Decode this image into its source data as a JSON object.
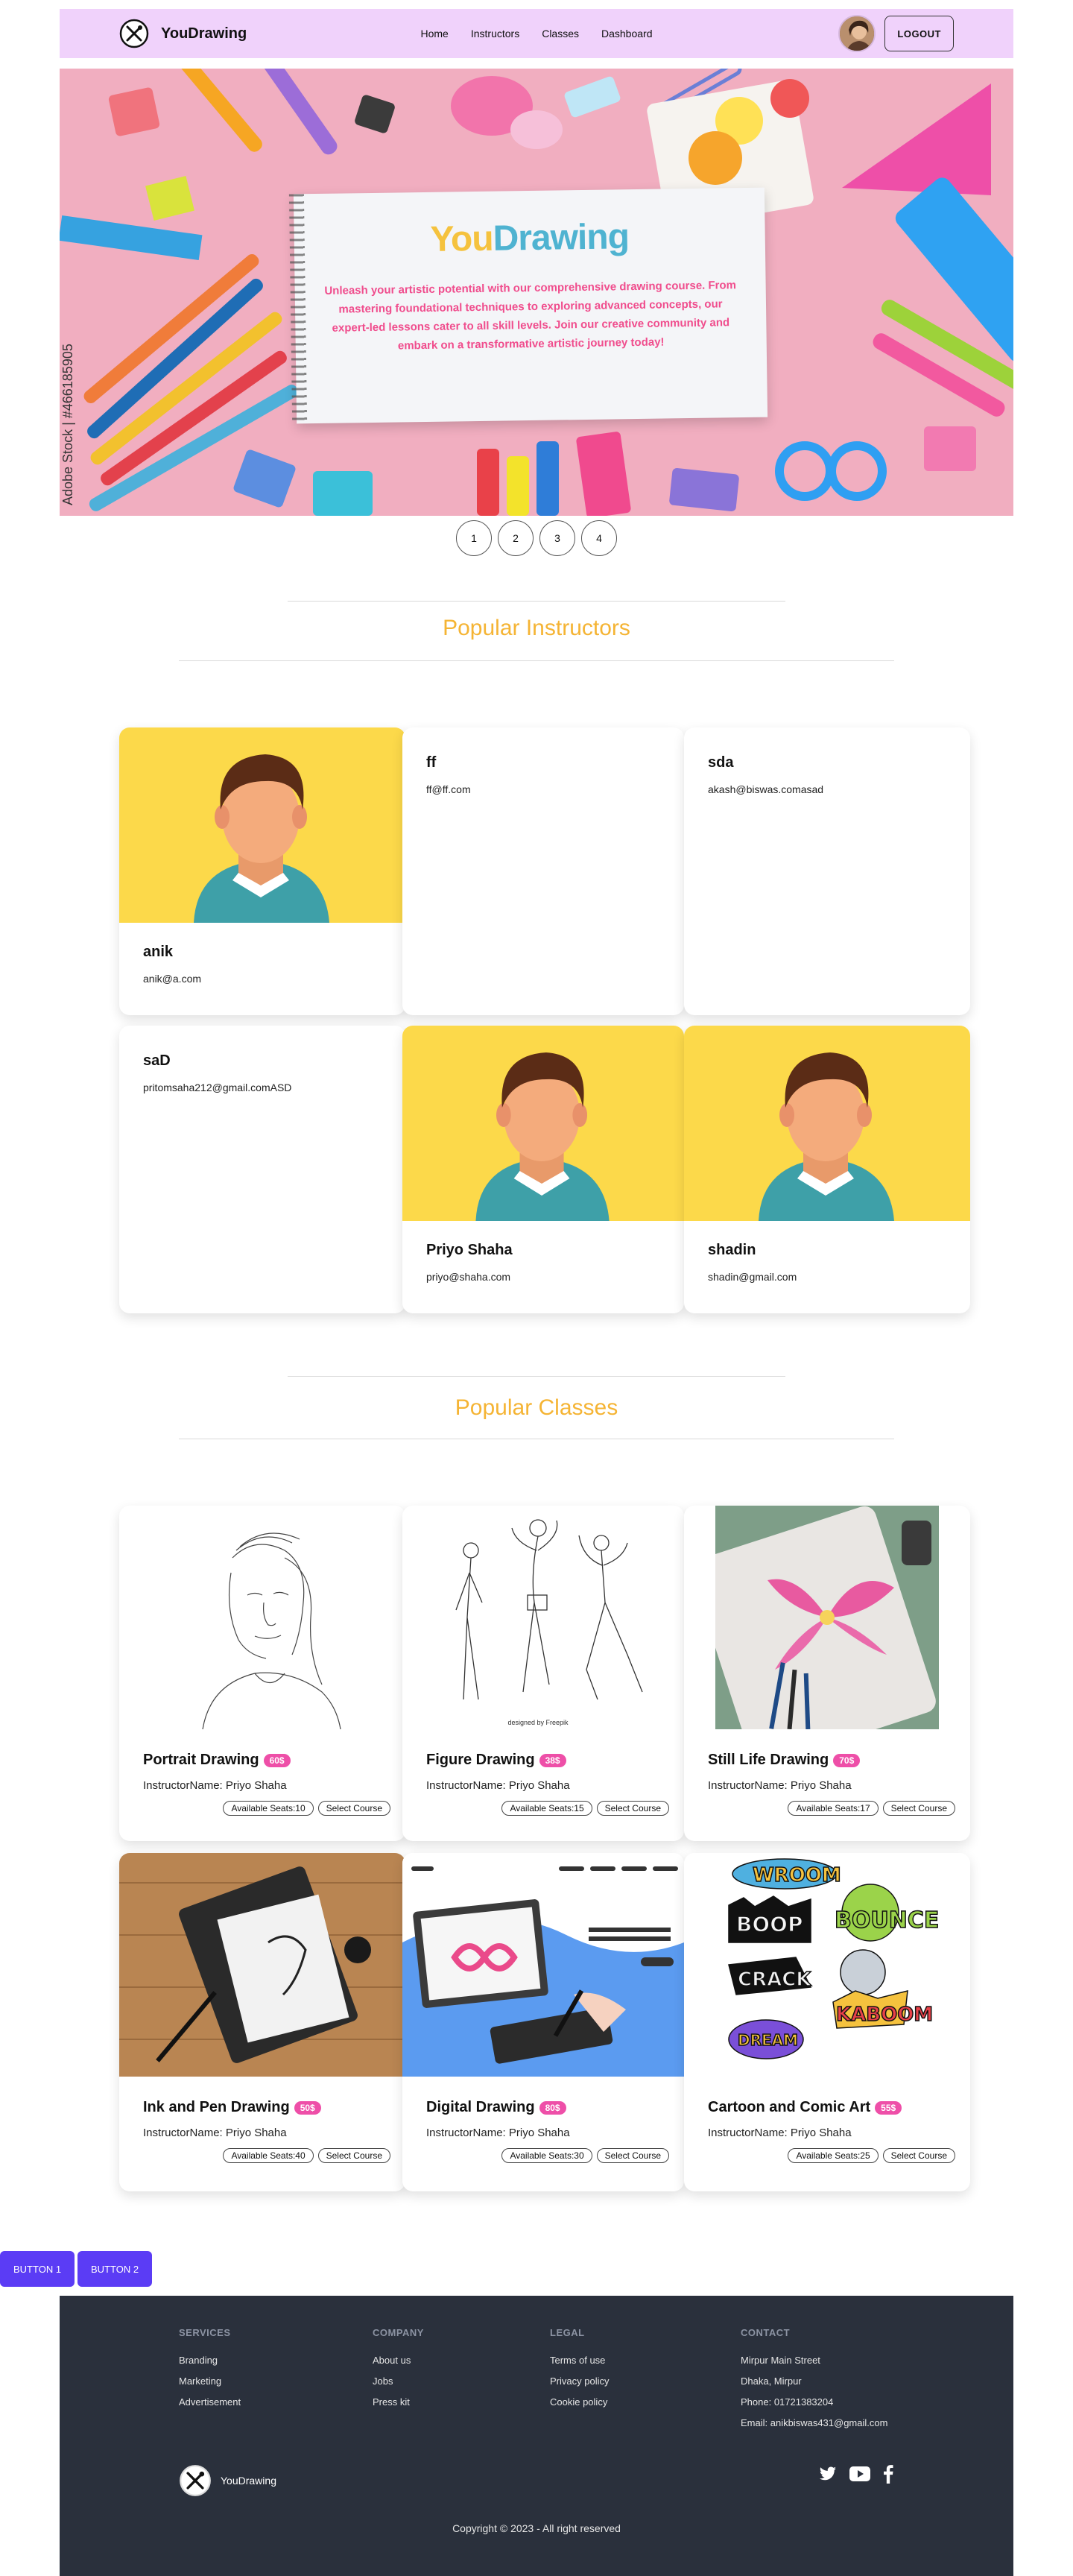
{
  "nav": {
    "brand": "YouDrawing",
    "links": [
      "Home",
      "Instructors",
      "Classes",
      "Dashboard"
    ],
    "logout_label": "LOGOUT"
  },
  "hero": {
    "title_part1": "You",
    "title_part2": "Drawing",
    "text": "Unleash your artistic potential with our comprehensive drawing course. From mastering foundational techniques to exploring advanced concepts, our expert-led lessons cater to all skill levels. Join our creative community and embark on a transformative artistic journey today!",
    "watermark": "Adobe Stock | #466185905"
  },
  "pagination": [
    "1",
    "2",
    "3",
    "4"
  ],
  "instructors_section": {
    "title": "Popular Instructors",
    "items": [
      {
        "name": "anik",
        "email": "anik@a.com",
        "has_photo": true
      },
      {
        "name": "ff",
        "email": "ff@ff.com",
        "has_photo": false
      },
      {
        "name": "sda",
        "email": "akash@biswas.comasad",
        "has_photo": false
      },
      {
        "name": "saD",
        "email": "pritomsaha212@gmail.comASD",
        "has_photo": false
      },
      {
        "name": "Priyo Shaha",
        "email": "priyo@shaha.com",
        "has_photo": true
      },
      {
        "name": "shadin",
        "email": "shadin@gmail.com",
        "has_photo": true
      }
    ]
  },
  "classes_section": {
    "title": "Popular Classes",
    "items": [
      {
        "title": "Portrait Drawing",
        "price": "60$",
        "instructor": "InstructorName: Priyo Shaha",
        "seats": "Available Seats:10",
        "select": "Select Course"
      },
      {
        "title": "Figure Drawing",
        "price": "38$",
        "instructor": "InstructorName: Priyo Shaha",
        "seats": "Available Seats:15",
        "select": "Select Course",
        "image_credit": "designed by Freepik"
      },
      {
        "title": "Still Life Drawing",
        "price": "70$",
        "instructor": "InstructorName: Priyo Shaha",
        "seats": "Available Seats:17",
        "select": "Select Course"
      },
      {
        "title": "Ink and Pen Drawing",
        "price": "50$",
        "instructor": "InstructorName: Priyo Shaha",
        "seats": "Available Seats:40",
        "select": "Select Course"
      },
      {
        "title": "Digital Drawing",
        "price": "80$",
        "instructor": "InstructorName: Priyo Shaha",
        "seats": "Available Seats:30",
        "select": "Select Course"
      },
      {
        "title": "Cartoon and Comic Art",
        "price": "55$",
        "instructor": "InstructorName: Priyo Shaha",
        "seats": "Available Seats:25",
        "select": "Select Course",
        "comic_words": [
          "WROOM",
          "BOOP",
          "BOUNCE",
          "CRACK",
          "KABOOM",
          "DREAM"
        ]
      }
    ]
  },
  "floating_buttons": [
    "BUTTON 1",
    "BUTTON 2"
  ],
  "footer": {
    "columns": [
      {
        "heading": "SERVICES",
        "items": [
          "Branding",
          "Marketing",
          "Advertisement"
        ]
      },
      {
        "heading": "COMPANY",
        "items": [
          "About us",
          "Jobs",
          "Press kit"
        ]
      },
      {
        "heading": "LEGAL",
        "items": [
          "Terms of use",
          "Privacy policy",
          "Cookie policy"
        ]
      },
      {
        "heading": "CONTACT",
        "items": [
          "Mirpur Main Street",
          "Dhaka, Mirpur",
          "Phone: 01721383204",
          "Email: anikbiswas431@gmail.com"
        ]
      }
    ],
    "brand": "YouDrawing",
    "social_icons": [
      "twitter-icon",
      "youtube-icon",
      "facebook-icon"
    ],
    "copyright": "Copyright © 2023 - All right reserved"
  },
  "colors": {
    "nav_bg": "#f0d2fb",
    "accent_heading": "#f5b434",
    "badge": "#ee4fa8",
    "footer_bg": "#2a303c",
    "button": "#5b3cf5"
  }
}
